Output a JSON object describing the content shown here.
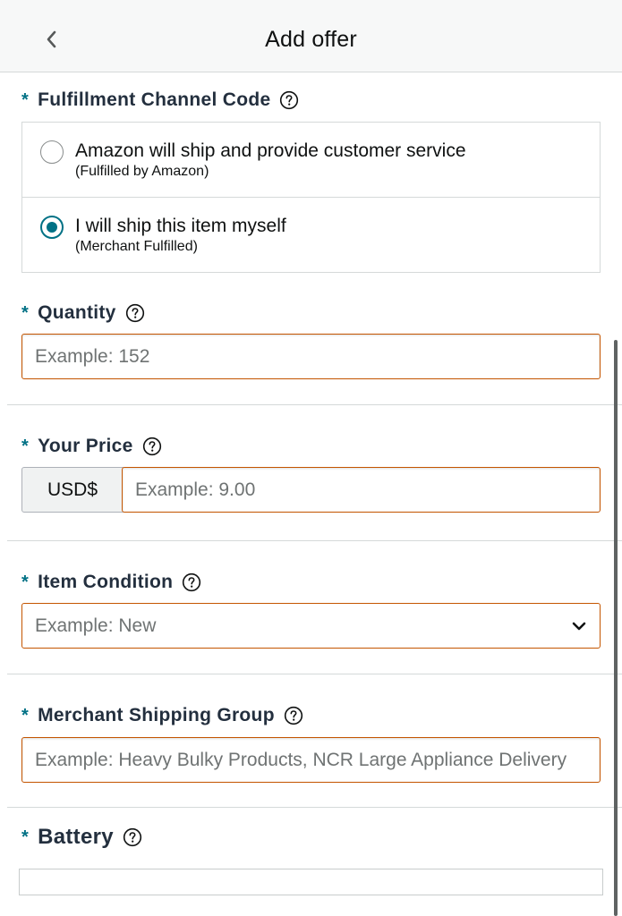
{
  "header": {
    "title": "Add offer",
    "back_icon": "chevron-left-icon"
  },
  "fulfillment": {
    "label": "Fulfillment Channel Code",
    "required_mark": "*",
    "options": [
      {
        "main": "Amazon will ship and provide customer service",
        "sub": "(Fulfilled by Amazon)",
        "selected": false
      },
      {
        "main": "I will ship this item myself",
        "sub": "(Merchant Fulfilled)",
        "selected": true
      }
    ]
  },
  "quantity": {
    "label": "Quantity",
    "required_mark": "*",
    "placeholder": "Example: 152",
    "value": ""
  },
  "price": {
    "label": "Your Price",
    "required_mark": "*",
    "currency": "USD$",
    "placeholder": "Example: 9.00",
    "value": ""
  },
  "condition": {
    "label": "Item Condition",
    "required_mark": "*",
    "placeholder": "Example: New"
  },
  "shipping_group": {
    "label": "Merchant Shipping Group",
    "required_mark": "*",
    "placeholder": "Example: Heavy Bulky Products, NCR Large Appliance Delivery"
  },
  "battery": {
    "label": "Battery",
    "required_mark": "*"
  },
  "colors": {
    "accent": "#007185",
    "error_border": "#c45500",
    "text": "#0f1111",
    "divider": "#d5d9d9"
  }
}
